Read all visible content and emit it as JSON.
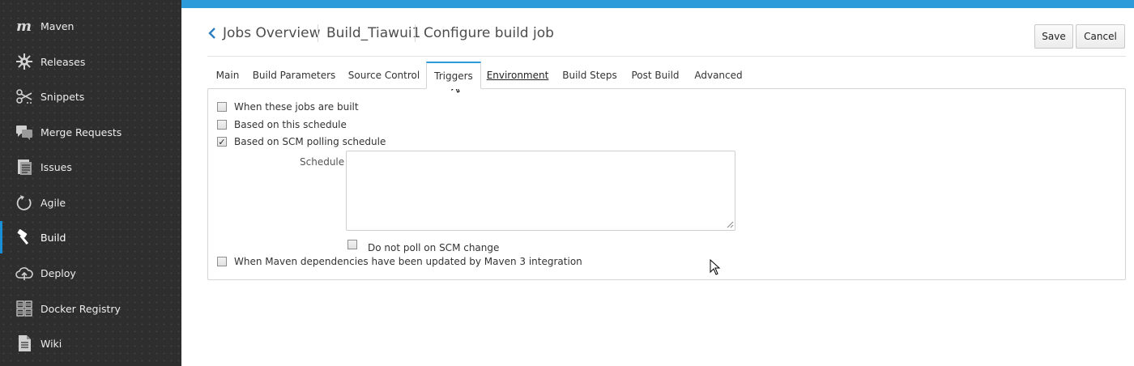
{
  "sidebar": {
    "items": [
      {
        "label": "Maven",
        "icon": "maven-logo-icon",
        "active": false
      },
      {
        "label": "Releases",
        "icon": "releases-icon",
        "active": false
      },
      {
        "label": "Snippets",
        "icon": "snippets-icon",
        "active": false
      },
      {
        "label": "Merge Requests",
        "icon": "merge-requests-icon",
        "active": false
      },
      {
        "label": "Issues",
        "icon": "issues-icon",
        "active": false
      },
      {
        "label": "Agile",
        "icon": "agile-icon",
        "active": false
      },
      {
        "label": "Build",
        "icon": "build-hammer-icon",
        "active": true
      },
      {
        "label": "Deploy",
        "icon": "deploy-cloud-icon",
        "active": false
      },
      {
        "label": "Docker Registry",
        "icon": "docker-registry-icon",
        "active": false
      },
      {
        "label": "Wiki",
        "icon": "wiki-icon",
        "active": false
      }
    ]
  },
  "header": {
    "breadcrumb": [
      "Jobs Overview",
      "Build_Tiawui1",
      "Configure build job"
    ],
    "save_label": "Save",
    "cancel_label": "Cancel"
  },
  "tabs": [
    {
      "label": "Main"
    },
    {
      "label": "Build Parameters"
    },
    {
      "label": "Source Control"
    },
    {
      "label": "Triggers"
    },
    {
      "label": "Environment"
    },
    {
      "label": "Build Steps"
    },
    {
      "label": "Post Build"
    },
    {
      "label": "Advanced"
    }
  ],
  "active_tab": "Triggers",
  "triggers": {
    "when_jobs_built": {
      "label": "When these jobs are built",
      "checked": false
    },
    "based_on_schedule": {
      "label": "Based on this schedule",
      "checked": false
    },
    "scm_polling": {
      "label": "Based on SCM polling schedule",
      "checked": true
    },
    "schedule_label": "Schedule",
    "schedule_value": "",
    "do_not_poll": {
      "label": "Do not poll on SCM change",
      "checked": false
    },
    "maven_deps": {
      "label": "When Maven dependencies have been updated by Maven 3 integration",
      "checked": false
    }
  },
  "colors": {
    "accent": "#2d9bd9",
    "sidebar_bg": "#2e2e2e",
    "active_indicator": "#1b8fd6"
  }
}
